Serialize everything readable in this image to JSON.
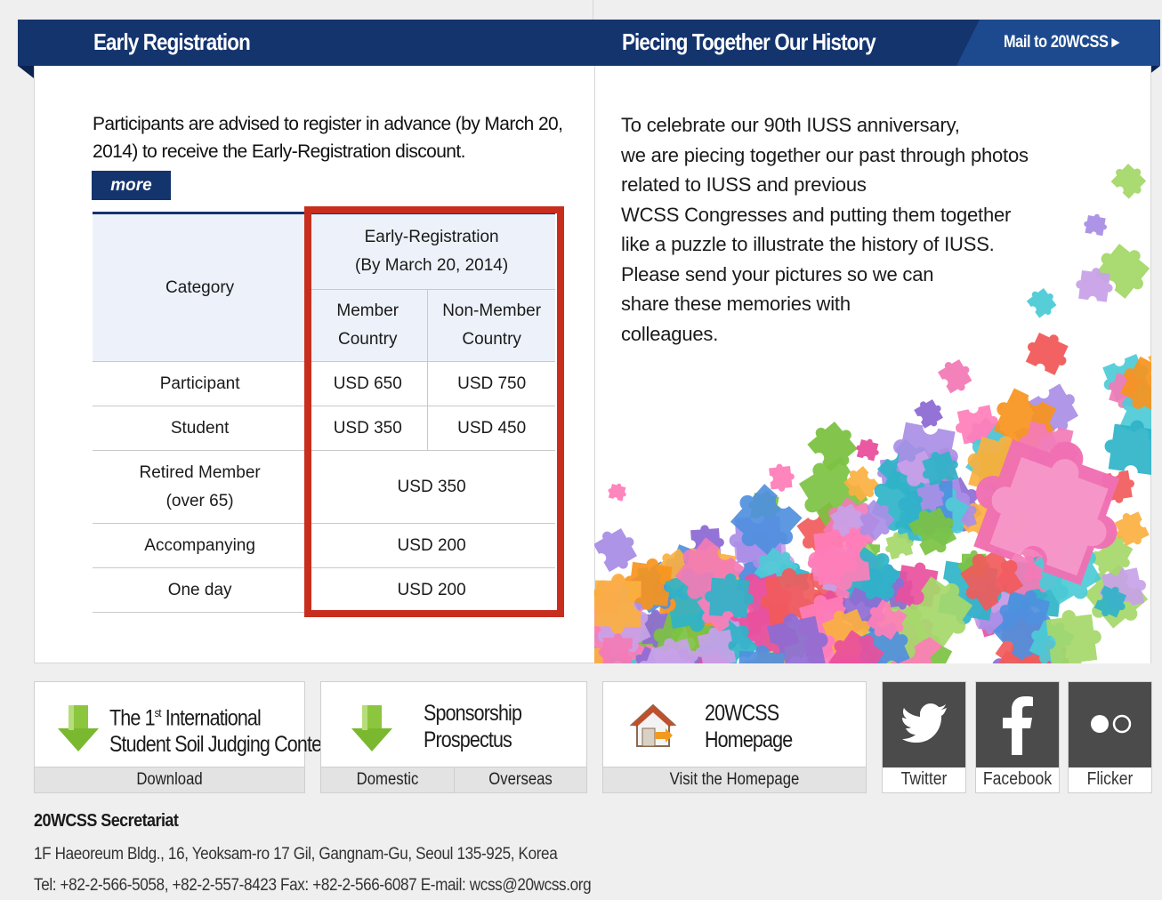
{
  "header": {
    "left_title": "Early Registration",
    "right_title": "Piecing Together Our History",
    "mail_link": "Mail to 20WCSS ▸"
  },
  "early_registration": {
    "intro": "Participants are advised to register in advance (by March 20, 2014) to receive the Early-Registration discount.",
    "more_button": "more",
    "table": {
      "category_header": "Category",
      "group_header_line1": "Early-Registration",
      "group_header_line2": "(By March 20, 2014)",
      "member_header_line1": "Member",
      "member_header_line2": "Country",
      "nonmember_header_line1": "Non-Member",
      "nonmember_header_line2": "Country",
      "rows": [
        {
          "category": "Participant",
          "member": "USD 650",
          "nonmember": "USD 750"
        },
        {
          "category": "Student",
          "member": "USD 350",
          "nonmember": "USD 450"
        },
        {
          "category_line1": "Retired Member",
          "category_line2": "(over 65)",
          "fee": "USD 350"
        },
        {
          "category": "Accompanying",
          "fee": "USD 200"
        },
        {
          "category": "One day",
          "fee": "USD 200"
        }
      ]
    }
  },
  "history": {
    "lines": [
      "To celebrate our 90th IUSS anniversary,",
      "we are piecing together our past through photos",
      "related to IUSS and previous",
      "WCSS Congresses and putting them together",
      "like a puzzle to illustrate the history of IUSS.",
      "Please send your pictures so we can",
      "share these memories with",
      "colleagues."
    ]
  },
  "tiles": {
    "contest": {
      "title_pre": "The 1",
      "title_sup": "st",
      "title_post": " International",
      "title_line2": "Student Soil Judging Contest",
      "link": "Download"
    },
    "sponsorship": {
      "title_line1": "Sponsorship",
      "title_line2": "Prospectus",
      "link_domestic": "Domestic",
      "link_overseas": "Overseas"
    },
    "homepage": {
      "title_line1": "20WCSS",
      "title_line2": "Homepage",
      "link": "Visit the Homepage"
    },
    "social": [
      {
        "label": "Twitter",
        "icon": "twitter-icon"
      },
      {
        "label": "Facebook",
        "icon": "facebook-icon"
      },
      {
        "label": "Flicker",
        "icon": "flickr-icon"
      }
    ]
  },
  "footer": {
    "title": "20WCSS Secretariat",
    "address": "1F Haeoreum Bldg., 16, Yeoksam-ro 17 Gil, Gangnam-Gu, Seoul 135-925, Korea",
    "contact": "Tel: +82-2-566-5058, +82-2-557-8423  Fax: +82-2-566-6087 E-mail: wcss@20wcss.org"
  },
  "colors": {
    "navy": "#14346e",
    "navy_light": "#1d4a8e",
    "highlight_red": "#c72e1e",
    "download_green": "#8cc63f",
    "social_grey": "#4b4b4b"
  }
}
